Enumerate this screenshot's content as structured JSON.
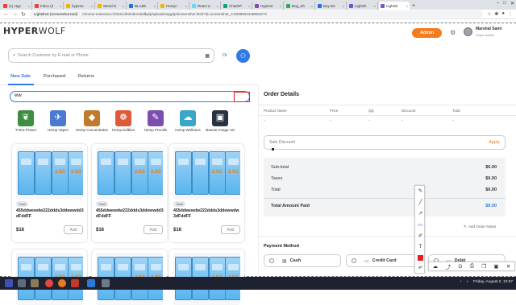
{
  "browser": {
    "tabs": [
      {
        "label": "(1) Hyp",
        "color": "#ea4335"
      },
      {
        "label": "Inbox (2",
        "color": "#ea4335"
      },
      {
        "label": "hyperw",
        "color": "#f4b400"
      },
      {
        "label": "Weed D",
        "color": "#f4b400"
      },
      {
        "label": "BLAZE",
        "color": "#1a73e8"
      },
      {
        "label": "Hemp i",
        "color": "#f4b400"
      },
      {
        "label": "React a",
        "color": "#61dafb"
      },
      {
        "label": "ChatGP",
        "color": "#10a37f"
      },
      {
        "label": "Hyperw",
        "color": "#8e44ad"
      },
      {
        "label": "Bug_Sh",
        "color": "#34a853"
      },
      {
        "label": "Buy De",
        "color": "#1a73e8"
      },
      {
        "label": "Lightsh",
        "color": "#7b4fd6"
      },
      {
        "label": "Lightsh",
        "color": "#7b4fd6",
        "active": true
      }
    ],
    "new_tab_glyph": "+",
    "url_site": "Lightshot (screenshot tool)",
    "url": "chrome-extension://mbniclmhobmnbdlbpiphghaielnnpgdp/screenshot.html?id=screenshot_0.5699934448694274"
  },
  "header": {
    "logo_bold": "HYPER",
    "logo_light": "WOLF",
    "admin_label": "Admin",
    "user_name": "Marshal Sami",
    "user_role": "Super Admin"
  },
  "customer": {
    "search_placeholder": "Search Customer by E-mail or Phone",
    "or_label": "Or"
  },
  "tabs": {
    "new_sale": "New Sale",
    "purchased": "Purchased",
    "returns": "Returns"
  },
  "product_search": {
    "value": "ww"
  },
  "categories": [
    {
      "label": "THCa Flower",
      "color": "#3e8e41",
      "glyph": "❦"
    },
    {
      "label": "Hemp Vapes",
      "color": "#4a7bd0",
      "glyph": "✈"
    },
    {
      "label": "Hemp Concentrates",
      "color": "#c07a2c",
      "glyph": "◆"
    },
    {
      "label": "Hemp Edibles",
      "color": "#e05a3a",
      "glyph": "❁"
    },
    {
      "label": "Hemp Prerolls",
      "color": "#7a4fb0",
      "glyph": "✎"
    },
    {
      "label": "Hemp Wellness",
      "color": "#3aa7c9",
      "glyph": "☁"
    },
    {
      "label": "Banner Image cat",
      "color": "#2a3140",
      "glyph": "▣"
    }
  ],
  "products": [
    {
      "brand": "Twirk",
      "name": "455ddwewdw222ddds3ddewwdd3dFddFF",
      "price": "$16",
      "add_label": "Add",
      "box_label": "2.5G"
    },
    {
      "brand": "Twirk",
      "name": "455ddwewdw222ddds3ddewwdd3dFddFF",
      "price": "$16",
      "add_label": "Add",
      "box_label": "2.5G"
    },
    {
      "brand": "Twirk",
      "name": "455ddwewdw222ddds3ddewwdw3dFddFF",
      "price": "$16",
      "add_label": "Add",
      "box_label": "2.5G"
    }
  ],
  "order": {
    "title": "Order Details",
    "columns": [
      "Product Name",
      "Price",
      "Qty",
      "Discount",
      "Total"
    ],
    "empty_row": [
      "-",
      "-",
      "-",
      "-",
      "-"
    ],
    "discount_placeholder": "Sale Discount",
    "apply_label": "Apply",
    "subtotal_label": "Sub-total",
    "subtotal": "$0.00",
    "taxes_label": "Taxes",
    "taxes": "$0.00",
    "total_label": "Total",
    "total": "$0.00",
    "amount_paid_label": "Total Amount Paid",
    "amount_paid": "$0.00",
    "add_notes_label": "Add Order Notes",
    "payment_title": "Payment Method",
    "payment_options": [
      "Cash",
      "Credit Card",
      "Debit"
    ]
  },
  "taskbar": {
    "clock": "Friday, August 2, 13:57"
  }
}
